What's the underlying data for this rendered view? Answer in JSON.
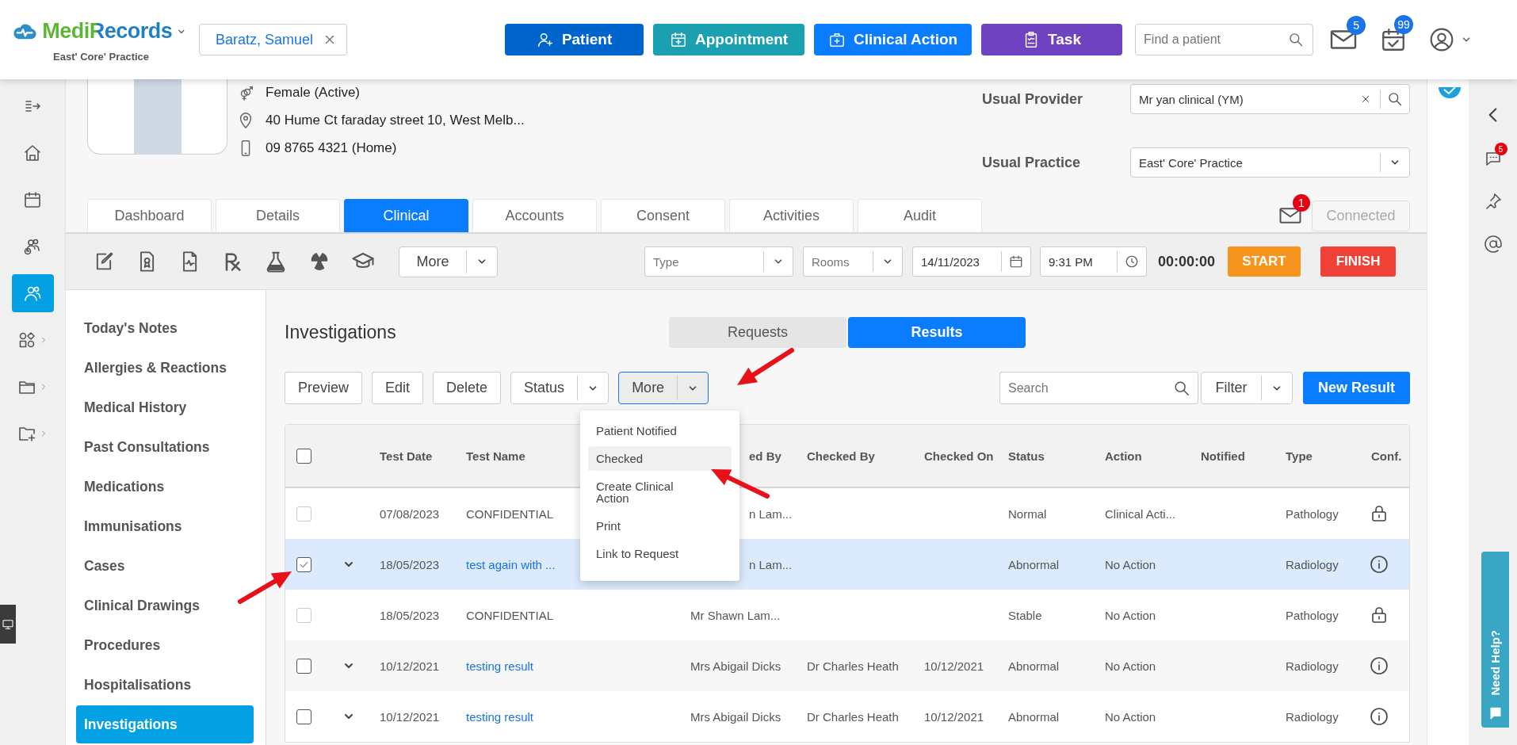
{
  "header": {
    "logo": "MediRecords",
    "practice": "East' Core' Practice",
    "patient_chip": "Baratz, Samuel",
    "actions": [
      {
        "label": "Patient",
        "kind": "patient"
      },
      {
        "label": "Appointment",
        "kind": "appointment"
      },
      {
        "label": "Clinical Action",
        "kind": "clinical"
      },
      {
        "label": "Task",
        "kind": "task"
      }
    ],
    "search": {
      "placeholder": "Find a patient"
    },
    "mail_badge": "5",
    "calendar_badge": "99"
  },
  "left_rail": [
    {
      "kind": "collapse",
      "selected": false
    },
    {
      "kind": "home",
      "selected": false
    },
    {
      "kind": "calendar",
      "selected": false
    },
    {
      "kind": "people-clock",
      "selected": false
    },
    {
      "kind": "people",
      "selected": true
    },
    {
      "kind": "shapes",
      "selected": false
    },
    {
      "kind": "folder",
      "selected": false
    },
    {
      "kind": "folder-plus",
      "selected": false
    }
  ],
  "patient": {
    "gender": "Female (Active)",
    "address": "40 Hume Ct faraday street 10, West Melb...",
    "phone": "09 8765 4321 (Home)",
    "usual_provider": {
      "label": "Usual Provider",
      "value": "Mr yan clinical (YM)"
    },
    "usual_practice": {
      "label": "Usual Practice",
      "value": "East' Core' Practice"
    }
  },
  "tabs": [
    {
      "label": "Dashboard",
      "selected": false
    },
    {
      "label": "Details",
      "selected": false
    },
    {
      "label": "Clinical",
      "selected": true
    },
    {
      "label": "Accounts",
      "selected": false
    },
    {
      "label": "Consent",
      "selected": false
    },
    {
      "label": "Activities",
      "selected": false
    },
    {
      "label": "Audit",
      "selected": false
    }
  ],
  "messages_badge": "1",
  "connected": {
    "label": "Connected",
    "disabled": true
  },
  "toolbar": {
    "more": "More",
    "type": {
      "placeholder": "Type"
    },
    "rooms": {
      "placeholder": "Rooms"
    },
    "date": "14/11/2023",
    "time": "9:31 PM",
    "timer": "00:00:00",
    "start": "START",
    "finish": "FINISH"
  },
  "nav": [
    {
      "label": "Today's Notes",
      "selected": false
    },
    {
      "label": "Allergies & Reactions",
      "selected": false
    },
    {
      "label": "Medical History",
      "selected": false
    },
    {
      "label": "Past Consultations",
      "selected": false
    },
    {
      "label": "Medications",
      "selected": false
    },
    {
      "label": "Immunisations",
      "selected": false
    },
    {
      "label": "Cases",
      "selected": false
    },
    {
      "label": "Clinical Drawings",
      "selected": false
    },
    {
      "label": "Procedures",
      "selected": false
    },
    {
      "label": "Hospitalisations",
      "selected": false
    },
    {
      "label": "Investigations",
      "selected": true
    }
  ],
  "content": {
    "title": "Investigations",
    "segments": [
      {
        "label": "Requests",
        "selected": false
      },
      {
        "label": "Results",
        "selected": true
      }
    ],
    "actions": [
      "Preview",
      "Edit",
      "Delete"
    ],
    "status": "Status",
    "more": "More",
    "search": {
      "placeholder": "Search"
    },
    "filter": "Filter",
    "new_result": "New Result"
  },
  "table": {
    "header_checked": false,
    "columns": [
      {
        "label": "Test Date"
      },
      {
        "label": "Test Name"
      },
      {
        "label": "ed By",
        "clipped": true
      },
      {
        "label": "Checked By"
      },
      {
        "label": "Checked On"
      },
      {
        "label": "Status"
      },
      {
        "label": "Action"
      },
      {
        "label": "Notified"
      },
      {
        "label": "Type"
      },
      {
        "label": "Conf."
      }
    ],
    "rows": [
      {
        "checked": false,
        "disabled": true,
        "selected": false,
        "expandable": false,
        "date": "07/08/2023",
        "name": "CONFIDENTIAL",
        "name_link": false,
        "by": {
          "text": "n Lam...",
          "clipped": true
        },
        "status": "Normal",
        "action": "Clinical Acti...",
        "type": "Pathology",
        "locked": true
      },
      {
        "checked": true,
        "disabled": false,
        "selected": true,
        "expandable": true,
        "date": "18/05/2023",
        "name": "test again with ...",
        "name_link": true,
        "by": {
          "text": "n Lam...",
          "clipped": true
        },
        "status": "Abnormal",
        "action": "No Action",
        "type": "Radiology",
        "locked": false
      },
      {
        "checked": false,
        "disabled": true,
        "selected": false,
        "expandable": false,
        "date": "18/05/2023",
        "name": "CONFIDENTIAL",
        "name_link": false,
        "by": {
          "text": "Mr Shawn Lam...",
          "clipped": false
        },
        "status": "Stable",
        "action": "No Action",
        "type": "Pathology",
        "locked": true
      },
      {
        "checked": false,
        "disabled": false,
        "selected": false,
        "expandable": true,
        "date": "10/12/2021",
        "name": "testing result",
        "name_link": true,
        "by": {
          "text": "Mrs Abigail Dicks",
          "clipped": false
        },
        "checked_by": "Dr Charles Heath",
        "checked_on": "10/12/2021",
        "status": "Abnormal",
        "action": "No Action",
        "type": "Radiology",
        "locked": false
      },
      {
        "checked": false,
        "disabled": false,
        "selected": false,
        "expandable": true,
        "date": "10/12/2021",
        "name": "testing result",
        "name_link": true,
        "by": {
          "text": "Mrs Abigail Dicks",
          "clipped": false
        },
        "checked_by": "Dr Charles Heath",
        "checked_on": "10/12/2021",
        "status": "Abnormal",
        "action": "No Action",
        "type": "Radiology",
        "locked": false
      }
    ]
  },
  "menu": {
    "items": [
      {
        "label": "Patient Notified",
        "selected": false
      },
      {
        "label": "Checked",
        "selected": true
      },
      {
        "label": "Create Clinical Action",
        "selected": false
      },
      {
        "label": "Print",
        "selected": false
      },
      {
        "label": "Link to Request",
        "selected": false
      }
    ]
  },
  "right_rail": {
    "chat_badge": "5"
  },
  "help": "Need Help?"
}
